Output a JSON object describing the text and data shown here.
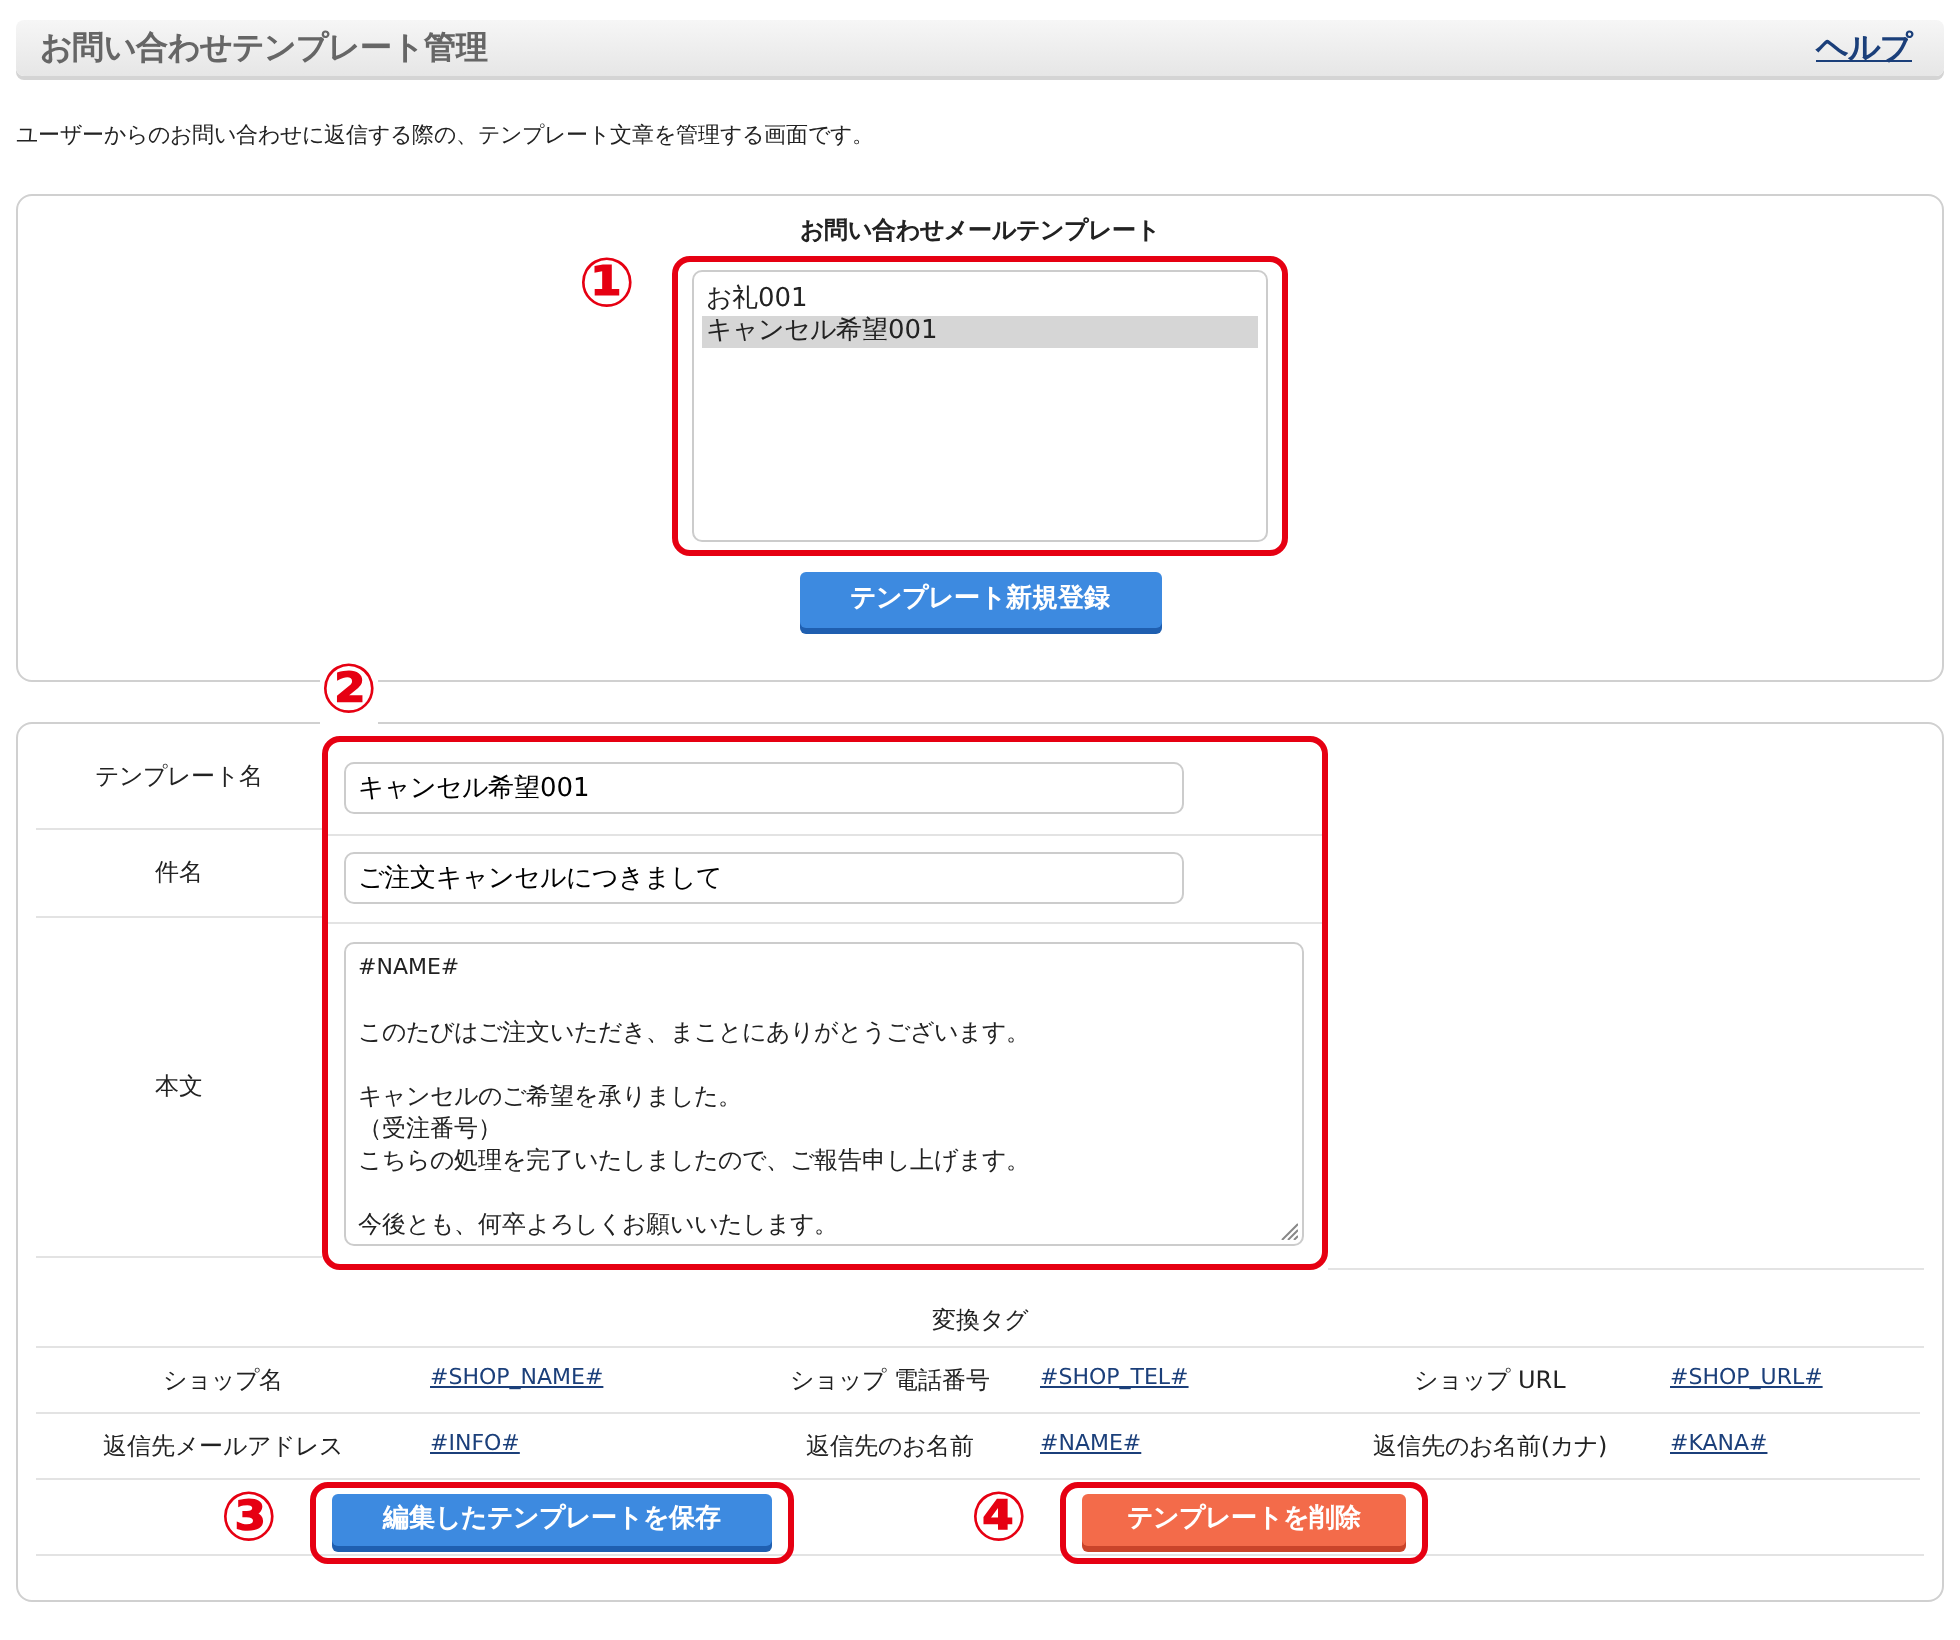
{
  "header": {
    "title": "お問い合わせテンプレート管理",
    "help_link": "ヘルプ"
  },
  "description": "ユーザーからのお問い合わせに返信する際の、テンプレート文章を管理する画面です。",
  "template_list": {
    "title": "お問い合わせメールテンプレート",
    "callout": "①",
    "items": [
      {
        "label": "お礼001",
        "selected": false
      },
      {
        "label": "キャンセル希望001",
        "selected": true
      }
    ],
    "new_button": "テンプレート新規登録"
  },
  "form": {
    "callout": "②",
    "fields": [
      {
        "label": "テンプレート名",
        "kind": "input",
        "value": "キャンセル希望001"
      },
      {
        "label": "件名",
        "kind": "input",
        "value": "ご注文キャンセルにつきまして"
      },
      {
        "label": "本文",
        "kind": "textarea",
        "paragraphs": [
          {
            "lines": [
              "#NAME#"
            ]
          },
          {
            "lines": [
              "このたびはご注文いただき、まことにありがとうございます。"
            ]
          },
          {
            "lines": [
              "キャンセルのご希望を承りました。",
              "（受注番号）",
              "こちらの処理を完了いたしましたので、ご報告申し上げます。"
            ]
          },
          {
            "lines": [
              "今後とも、何卒よろしくお願いいたします。"
            ]
          }
        ]
      }
    ]
  },
  "tags": {
    "title": "変換タグ",
    "items": [
      {
        "label": "ショップ名",
        "tag": "#SHOP_NAME#"
      },
      {
        "label": "ショップ 電話番号",
        "tag": "#SHOP_TEL#"
      },
      {
        "label": "ショップ URL",
        "tag": "#SHOP_URL#"
      },
      {
        "label": "返信先メールアドレス",
        "tag": "#INFO#"
      },
      {
        "label": "返信先のお名前",
        "tag": "#NAME#"
      },
      {
        "label": "返信先のお名前(カナ)",
        "tag": "#KANA#"
      }
    ]
  },
  "actions": [
    {
      "label": "編集したテンプレートを保存",
      "kind": "save",
      "callout": "③"
    },
    {
      "label": "テンプレートを削除",
      "kind": "delete",
      "callout": "④"
    }
  ]
}
